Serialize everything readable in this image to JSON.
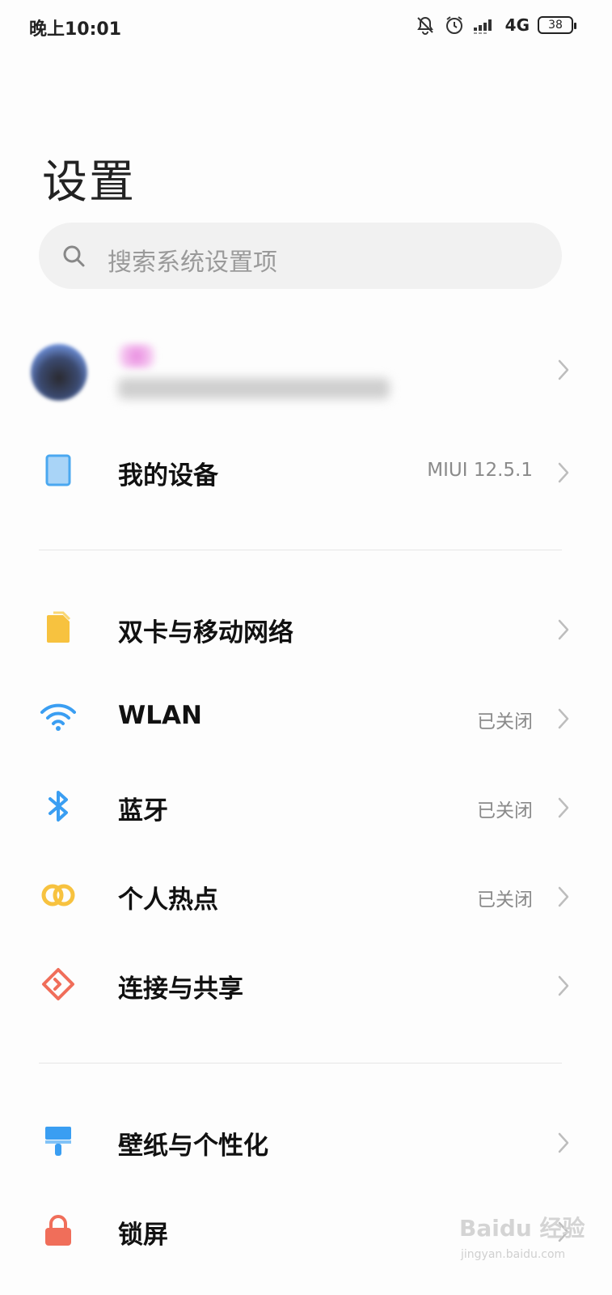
{
  "status_bar": {
    "time": "晚上10:01",
    "network": "4G",
    "battery": "38",
    "icons": [
      "bell-off-icon",
      "alarm-icon",
      "signal-icon",
      "battery-icon"
    ]
  },
  "title": "设置",
  "search": {
    "placeholder": "搜索系统设置项"
  },
  "account": {
    "chevron": "chevron-right-icon"
  },
  "device_section": [
    {
      "label": "我的设备",
      "value": "MIUI 12.5.1",
      "icon": "tablet-icon",
      "color": "#4aa8f0"
    }
  ],
  "network_section": [
    {
      "label": "双卡与移动网络",
      "value": "",
      "icon": "sim-card-icon",
      "color": "#f7c23f"
    },
    {
      "label": "WLAN",
      "value": "已关闭",
      "icon": "wifi-icon",
      "color": "#3a9ef2"
    },
    {
      "label": "蓝牙",
      "value": "已关闭",
      "icon": "bluetooth-icon",
      "color": "#3a9ef2"
    },
    {
      "label": "个人热点",
      "value": "已关闭",
      "icon": "hotspot-icon",
      "color": "#f7c23f"
    },
    {
      "label": "连接与共享",
      "value": "",
      "icon": "share-icon",
      "color": "#f06e5a"
    }
  ],
  "personal_section": [
    {
      "label": "壁纸与个性化",
      "value": "",
      "icon": "paintbrush-icon",
      "color": "#3a9ef2"
    },
    {
      "label": "锁屏",
      "value": "",
      "icon": "lock-icon",
      "color": "#f06e5a"
    }
  ],
  "watermark": {
    "brand": "Baidu 经验",
    "url": "jingyan.baidu.com"
  }
}
